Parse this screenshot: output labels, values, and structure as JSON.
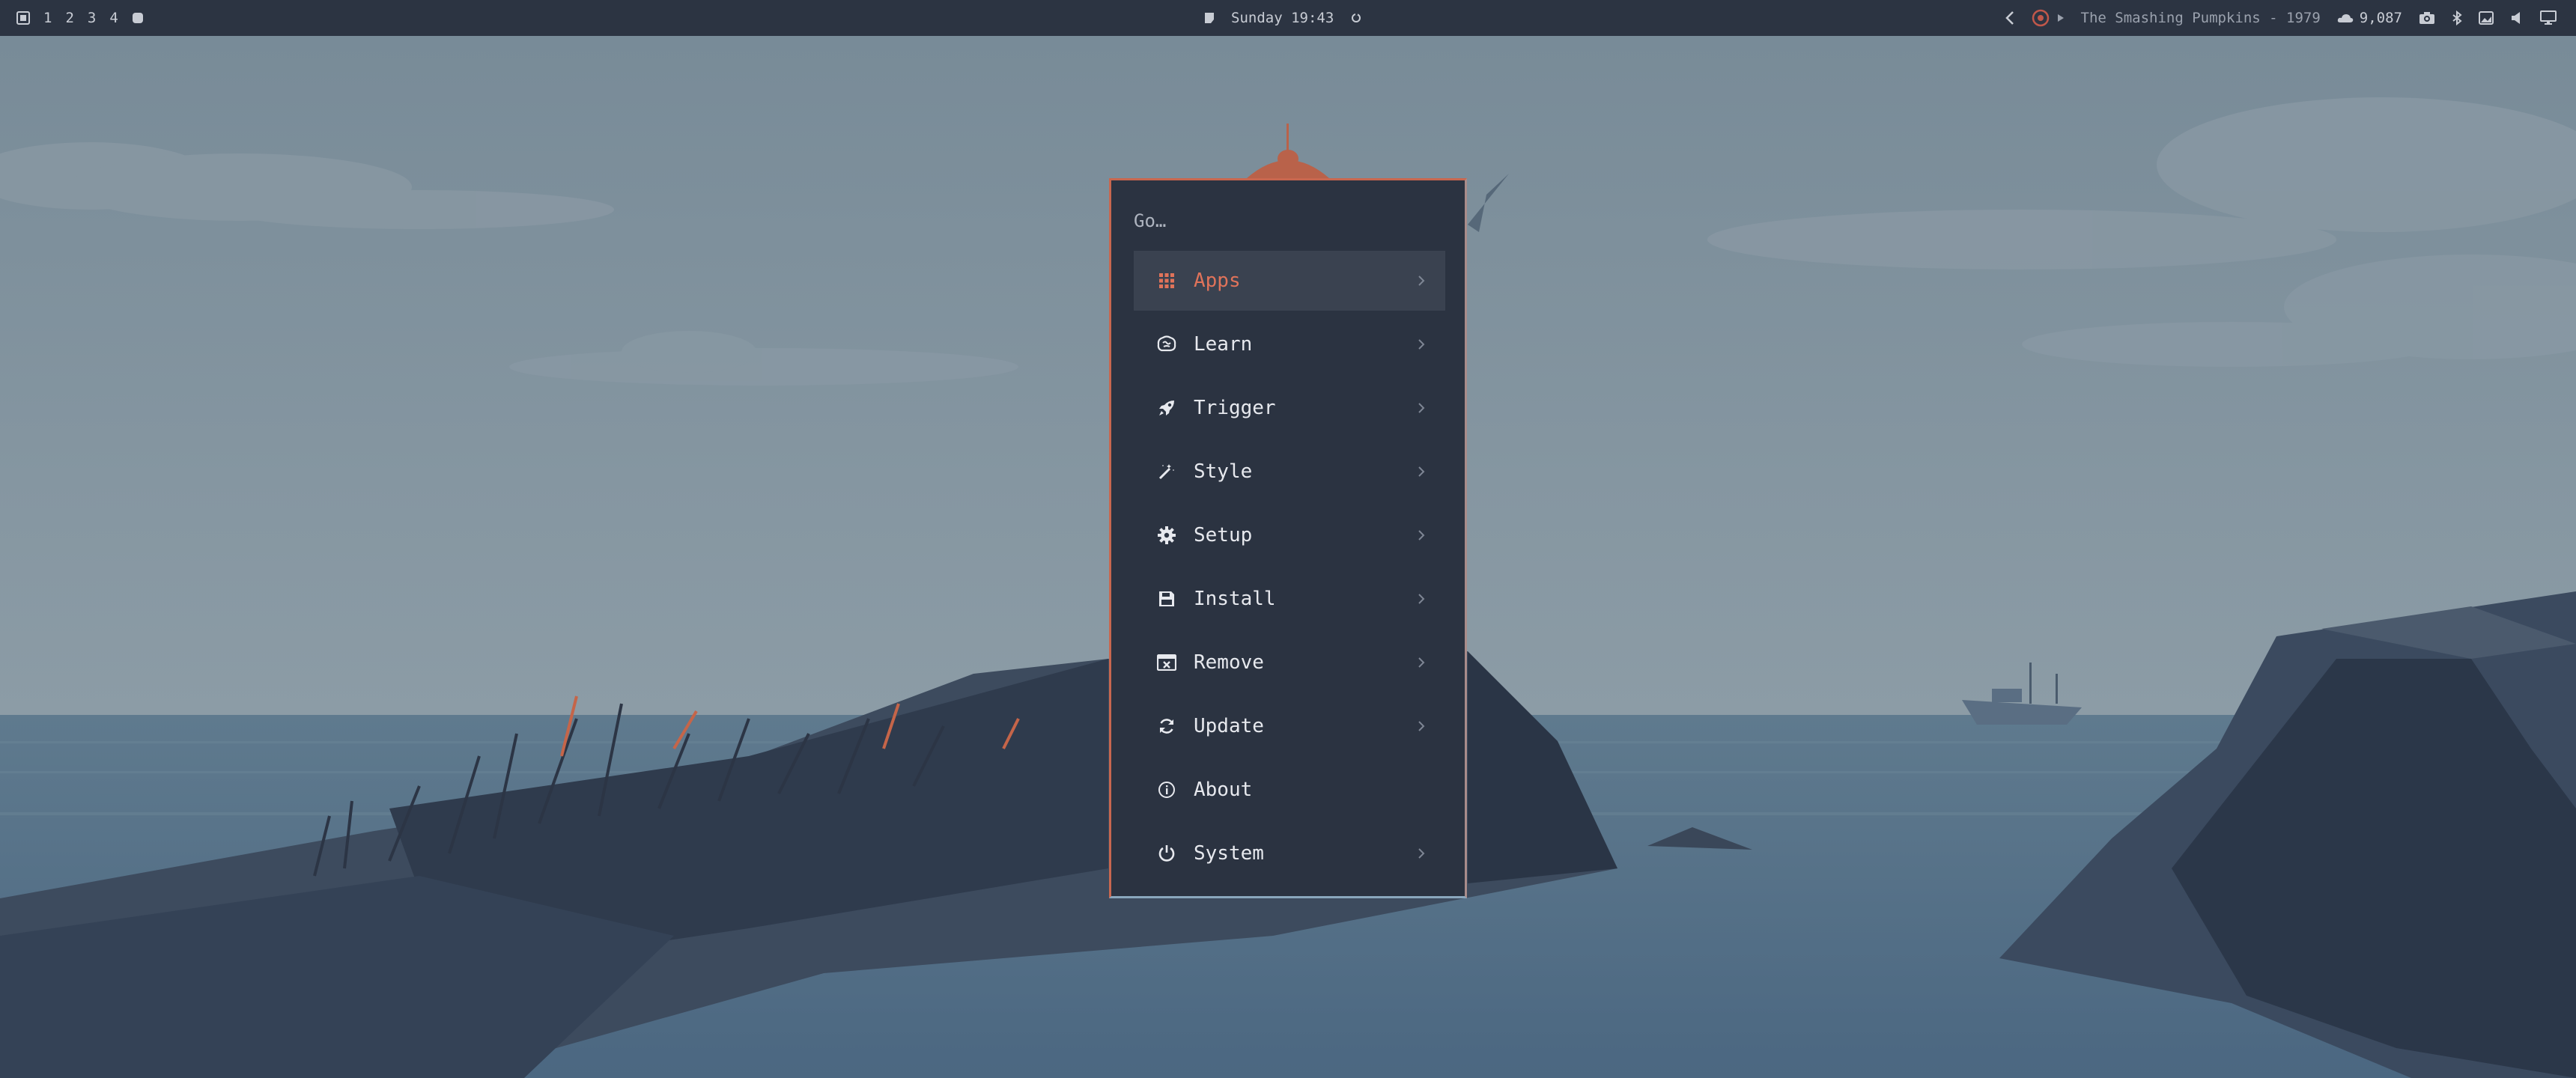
{
  "topbar": {
    "workspaces": [
      "1",
      "2",
      "3",
      "4"
    ],
    "clock": "Sunday 19:43",
    "media": "The Smashing Pumpkins - 1979",
    "weather": "9,087"
  },
  "launcher": {
    "prompt": "Go…",
    "items": [
      {
        "label": "Apps",
        "icon": "grid-icon",
        "submenu": true,
        "active": true
      },
      {
        "label": "Learn",
        "icon": "brain-icon",
        "submenu": true
      },
      {
        "label": "Trigger",
        "icon": "rocket-icon",
        "submenu": true
      },
      {
        "label": "Style",
        "icon": "magic-wand-icon",
        "submenu": true
      },
      {
        "label": "Setup",
        "icon": "gear-icon",
        "submenu": true
      },
      {
        "label": "Install",
        "icon": "floppy-disk-icon",
        "submenu": true
      },
      {
        "label": "Remove",
        "icon": "window-close-icon",
        "submenu": true
      },
      {
        "label": "Update",
        "icon": "refresh-icon",
        "submenu": true
      },
      {
        "label": "About",
        "icon": "info-icon",
        "submenu": false
      },
      {
        "label": "System",
        "icon": "power-icon",
        "submenu": true
      }
    ]
  },
  "colors": {
    "bar_bg": "#2c3442",
    "menu_bg": "#2b3341",
    "accent": "#e0735a",
    "text": "#e7e9ee"
  }
}
